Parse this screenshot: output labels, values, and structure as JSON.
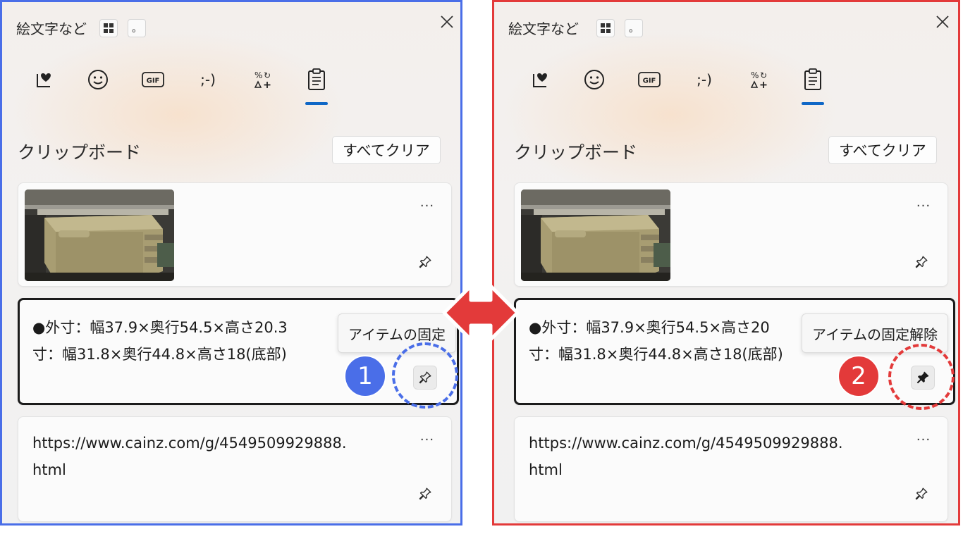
{
  "colors": {
    "left_frame": "#4a6ee8",
    "right_frame": "#e33a3a",
    "tab_indicator": "#0f67c6",
    "step1_badge": "#4a6ee8",
    "step2_badge": "#e33a3a",
    "arrow": "#e33a3a"
  },
  "left": {
    "header": {
      "title": "絵文字など",
      "keyboard_layout_icon": "grid-icon",
      "ime_label": "。",
      "close_icon": "close-icon"
    },
    "tabs": [
      {
        "icon": "heart-square-icon"
      },
      {
        "icon": "smiley-icon"
      },
      {
        "icon": "gif-icon",
        "label": "GIF"
      },
      {
        "icon": "kaomoji-icon",
        "label": ";-)"
      },
      {
        "icon": "symbols-icon"
      },
      {
        "icon": "clipboard-icon",
        "selected": true
      }
    ],
    "section_title": "クリップボード",
    "clear_all_label": "すべてクリア",
    "items": [
      {
        "type": "image",
        "more_label": "···",
        "pinned": false
      },
      {
        "type": "text",
        "text": "●外寸：幅37.9×奥行54.5×高さ20.3\n寸：幅31.8×奥行44.8×高さ18(底部)",
        "pinned": false,
        "tooltip": "アイテムの固定"
      },
      {
        "type": "text",
        "text": "https://www.cainz.com/g/4549509929888.\nhtml",
        "more_label": "···",
        "pinned": false
      }
    ],
    "step_label": "1"
  },
  "right": {
    "header": {
      "title": "絵文字など",
      "keyboard_layout_icon": "grid-icon",
      "ime_label": "。",
      "close_icon": "close-icon"
    },
    "tabs": [
      {
        "icon": "heart-square-icon"
      },
      {
        "icon": "smiley-icon"
      },
      {
        "icon": "gif-icon",
        "label": "GIF"
      },
      {
        "icon": "kaomoji-icon",
        "label": ";-)"
      },
      {
        "icon": "symbols-icon"
      },
      {
        "icon": "clipboard-icon",
        "selected": true
      }
    ],
    "section_title": "クリップボード",
    "clear_all_label": "すべてクリア",
    "items": [
      {
        "type": "image",
        "more_label": "···",
        "pinned": false
      },
      {
        "type": "text",
        "text": "●外寸：幅37.9×奥行54.5×高さ20\n寸：幅31.8×奥行44.8×高さ18(底部)",
        "pinned": true,
        "tooltip": "アイテムの固定解除"
      },
      {
        "type": "text",
        "text": "https://www.cainz.com/g/4549509929888.\nhtml",
        "more_label": "···",
        "pinned": false
      }
    ],
    "step_label": "2"
  }
}
